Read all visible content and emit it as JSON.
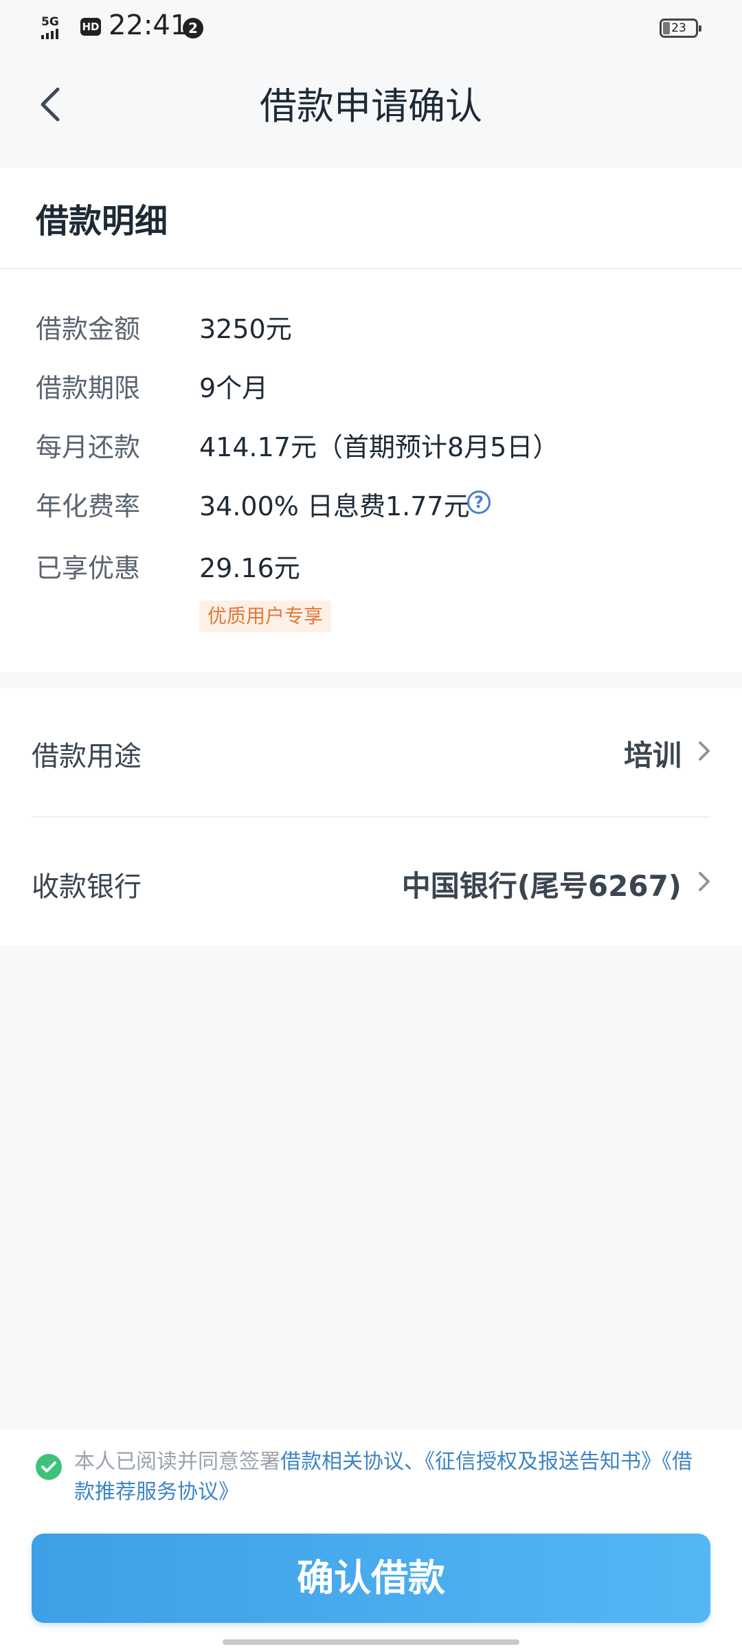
{
  "status_bar": {
    "network": "5G",
    "hd": "HD",
    "time": "22:41",
    "notification_count": "2",
    "battery": "23"
  },
  "header": {
    "title": "借款申请确认"
  },
  "detail": {
    "title": "借款明细",
    "rows": [
      {
        "label": "借款金额",
        "value": "3250元"
      },
      {
        "label": "借款期限",
        "value": "9个月"
      },
      {
        "label": "每月还款",
        "value": "414.17元（首期预计8月5日）"
      },
      {
        "label": "年化费率",
        "value": "34.00% 日息费1.77元"
      },
      {
        "label": "已享优惠",
        "value": "29.16元"
      }
    ],
    "help_glyph": "?",
    "discount_tag": "优质用户专享"
  },
  "options": {
    "purpose": {
      "label": "借款用途",
      "value": "培训"
    },
    "bank": {
      "label": "收款银行",
      "value": "中国银行(尾号6267)"
    }
  },
  "agreement": {
    "prefix": "本人已阅读并同意签署",
    "links": [
      "借款相关协议",
      "、",
      "《征信授权及报送告知书》",
      "《借款推荐服务协议》"
    ]
  },
  "confirm_label": "确认借款",
  "colors": {
    "primary": "#3d9fe6",
    "check": "#3fc17a",
    "tag_bg": "#fdf0e6",
    "tag_text": "#e07a3a"
  }
}
